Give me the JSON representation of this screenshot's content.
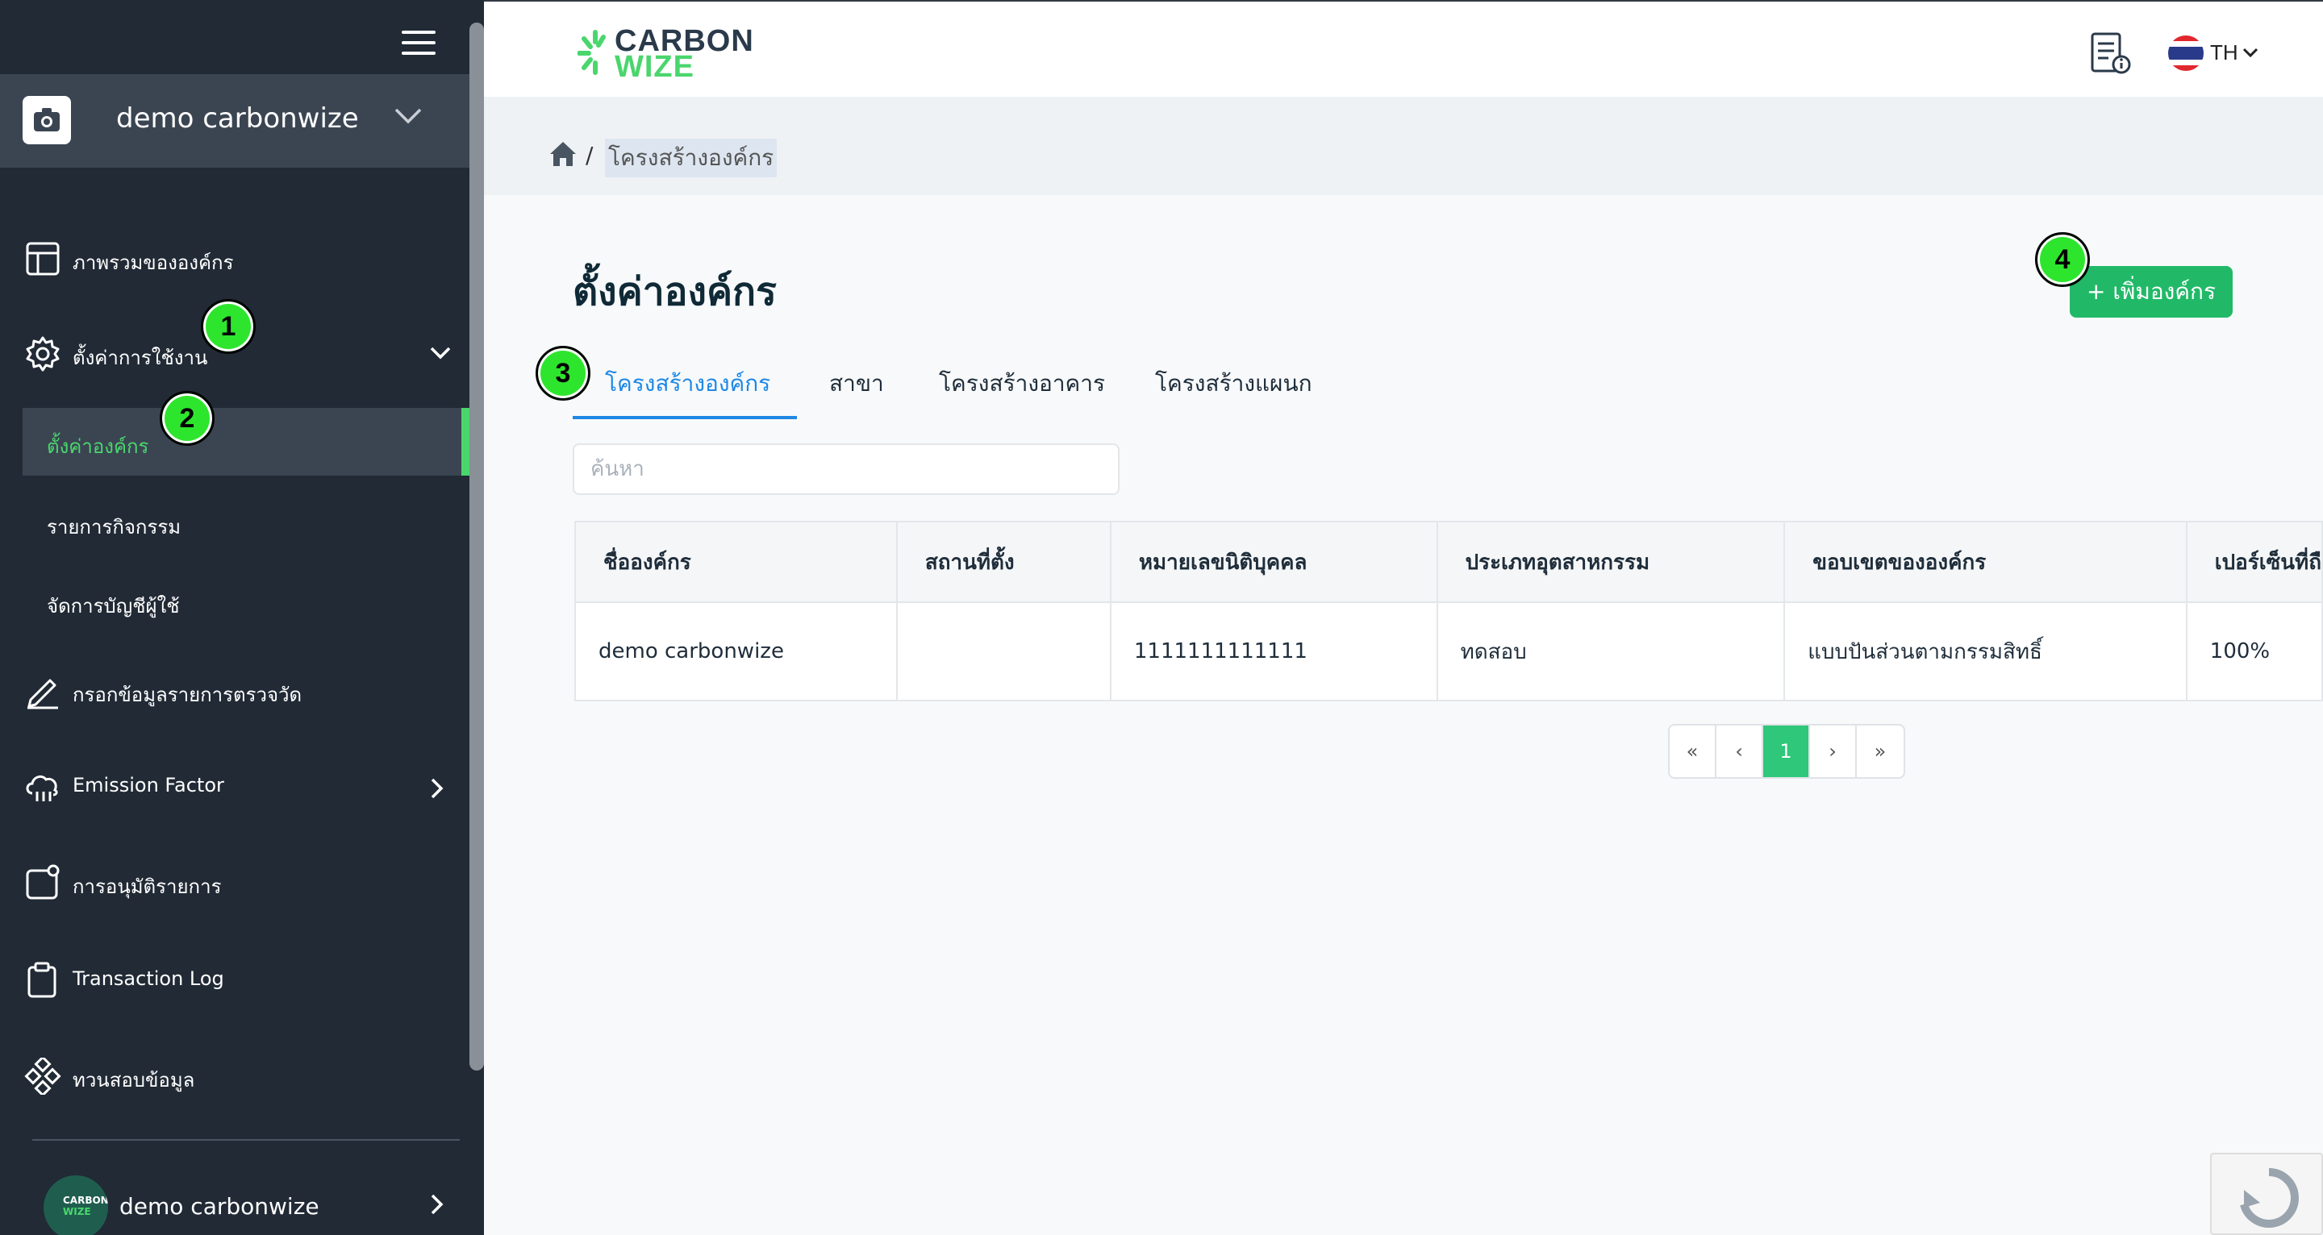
{
  "sidebar": {
    "org_name": "demo carbonwize",
    "items": [
      {
        "label": "ภาพรวมขององค์กร"
      },
      {
        "label": "ตั้งค่าการใช้งาน"
      },
      {
        "label": "ตั้งค่าองค์กร"
      },
      {
        "label": "รายการกิจกรรม"
      },
      {
        "label": "จัดการบัญชีผู้ใช้"
      },
      {
        "label": "กรอกข้อมูลรายการตรวจวัด"
      },
      {
        "label": "Emission Factor"
      },
      {
        "label": "การอนุมัติรายการ"
      },
      {
        "label": "Transaction Log"
      },
      {
        "label": "ทวนสอบข้อมูล"
      }
    ],
    "user_name": "demo carbonwize",
    "avatar_text_1": "CARBON",
    "avatar_text_2": "WIZE"
  },
  "header": {
    "logo_line1": "CARBON",
    "logo_line2": "WIZE",
    "language": "TH"
  },
  "breadcrumb": {
    "current": "โครงสร้างองค์กร",
    "separator": "/"
  },
  "main": {
    "title": "ตั้งค่าองค์กร",
    "add_button": "+ เพิ่มองค์กร",
    "tabs": [
      {
        "label": "โครงสร้างองค์กร",
        "active": true
      },
      {
        "label": "สาขา"
      },
      {
        "label": "โครงสร้างอาคาร"
      },
      {
        "label": "โครงสร้างแผนก"
      }
    ],
    "search_placeholder": "ค้นหา",
    "table": {
      "headers": [
        "ชื่อองค์กร",
        "สถานที่ตั้ง",
        "หมายเลขนิติบุคคล",
        "ประเภทอุตสาหกรรม",
        "ขอบเขตขององค์กร",
        "เปอร์เซ็นที่ถื"
      ],
      "rows": [
        [
          "demo carbonwize",
          "",
          "1111111111111",
          "ทดสอบ",
          "แบบปันส่วนตามกรรมสิทธิ์",
          "100%"
        ]
      ]
    },
    "pagination": {
      "first": "«",
      "prev": "‹",
      "current": "1",
      "next": "›",
      "last": "»"
    }
  },
  "markers": [
    "1",
    "2",
    "3",
    "4"
  ],
  "colors": {
    "sidebar_bg": "#212a35",
    "accent_green": "#4ad66d",
    "button_green": "#21b968",
    "tab_blue": "#1e88e5",
    "marker_green": "#2ee52e"
  }
}
